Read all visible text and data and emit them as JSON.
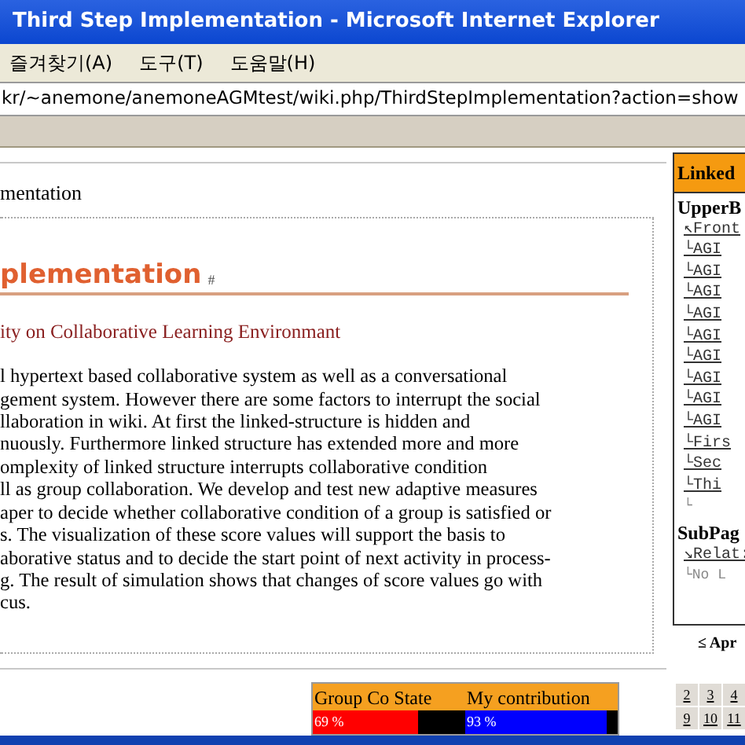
{
  "window": {
    "title": "Third Step Implementation - Microsoft Internet Explorer"
  },
  "menu": [
    "즐겨찾기(A)",
    "도구(T)",
    "도움말(H)"
  ],
  "address": "kr/~anemone/anemoneAGMtest/wiki.php/ThirdStepImplementation?action=show",
  "breadcrumb": "mentation",
  "heading": "plementation",
  "anchor": "#",
  "subtitle": "ity on Collaborative Learning Environmant",
  "paragraph": [
    "l hypertext based collaborative system as well as a conversational",
    "gement system. However there are some factors to interrupt the social",
    "llaboration in wiki. At first the linked-structure is hidden and",
    "nuously. Furthermore linked structure has extended more and more",
    "omplexity of linked structure interrupts collaborative condition",
    "ll as group collaboration. We develop and test new adaptive measures",
    "aper to decide whether collaborative condition of a group is satisfied or",
    "s. The visualization of these score values will support the basis to",
    "aborative status and to decide the start point of next activity in process-",
    "g. The result of simulation shows that changes of score values go with",
    "cus."
  ],
  "meters": [
    {
      "label": "Group Co State",
      "reading": "69 %",
      "level": 0.69,
      "color": "#ff0000"
    },
    {
      "label": "My contribution",
      "reading": "93 %",
      "level": 0.93,
      "color": "#0000ff"
    }
  ],
  "sidebar": {
    "title": "Linked",
    "sections": [
      {
        "heading": "UpperB",
        "items": [
          {
            "label": "↖Front",
            "kind": "link"
          },
          {
            "label": "└AGI",
            "kind": "link"
          },
          {
            "label": "└AGI",
            "kind": "link"
          },
          {
            "label": "└AGI",
            "kind": "link"
          },
          {
            "label": "└AGI",
            "kind": "link"
          },
          {
            "label": "└AGI",
            "kind": "link"
          },
          {
            "label": "└AGI",
            "kind": "link"
          },
          {
            "label": "└AGI",
            "kind": "link"
          },
          {
            "label": "└AGI",
            "kind": "link"
          },
          {
            "label": "└AGI",
            "kind": "link"
          },
          {
            "label": "└Firs",
            "kind": "link"
          },
          {
            "label": "└Sec",
            "kind": "link"
          },
          {
            "label": "└Thi",
            "kind": "link"
          },
          {
            "label": "└",
            "kind": "note"
          }
        ]
      },
      {
        "heading": "SubPag",
        "items": [
          {
            "label": "↘Relat:",
            "kind": "link"
          },
          {
            "label": "└No L",
            "kind": "note"
          }
        ]
      }
    ]
  },
  "calendar": {
    "month": "≤ Apr",
    "days": [
      [
        "2",
        "3",
        "4"
      ],
      [
        "9",
        "10",
        "11"
      ]
    ]
  }
}
